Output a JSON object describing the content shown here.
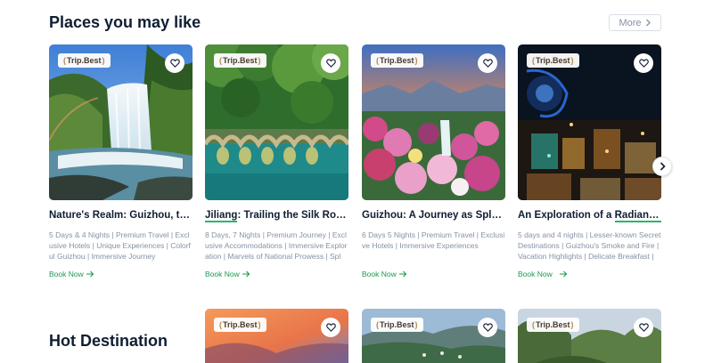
{
  "section1": {
    "title": "Places you may like",
    "more_label": "More"
  },
  "badge_text": "Trip.Best",
  "cards": [
    {
      "title": "Nature's Realm: Guizhou, the Land of Mountains",
      "title_plain": "Nature's Realm: Guizhou, the...",
      "description": "5 Days & 4 Nights | Premium Travel | Exclusive Hotels | Unique Experiences | Colorful Guizhou | Immersive Journey",
      "book_label": "Book Now"
    },
    {
      "title_underlined": "Jiliang",
      "title_rest": ": Trailing the Silk Road...",
      "description": "8 Days, 7 Nights | Premium Journey | Exclusive Accommodations | Immersive Exploration | Marvels of National Prowess | Spl",
      "book_label": "Book Now"
    },
    {
      "title_plain": "Guizhou: A Journey as Splen...",
      "description": "6 Days 5 Nights | Premium Travel | Exclusive Hotels | Immersive Experiences",
      "book_label": "Book Now"
    },
    {
      "title_start": "An Exploration of a ",
      "title_underlined": "Radiant ...",
      "description": "5 days and 4 nights | Lesser-known Secret Destinations | Guizhou's Smoke and Fire | Vacation Highlights | Delicate Breakfast |",
      "book_label": "Book Now"
    }
  ],
  "section2": {
    "title": "Hot Destination"
  },
  "icons": {
    "favorite": "heart-icon",
    "more": "chevron-right-icon",
    "next": "chevron-right-icon",
    "book": "arrow-right-icon"
  },
  "colors": {
    "accent_green": "#1a9a50",
    "title_dark": "#0f1e33",
    "muted": "#8592a6"
  }
}
